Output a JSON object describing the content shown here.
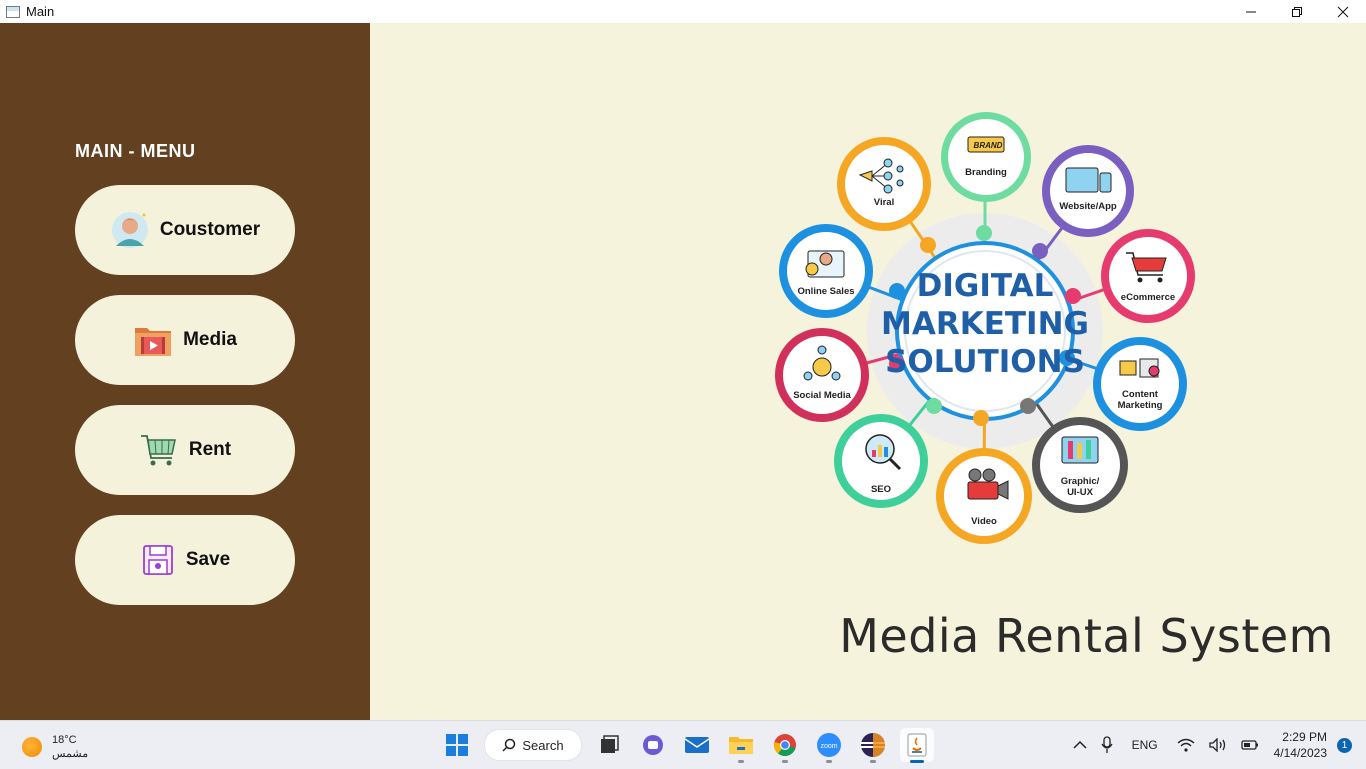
{
  "window": {
    "title": "Main"
  },
  "sidebar": {
    "menu_title": "MAIN - MENU",
    "buttons": [
      {
        "label": "Coustomer",
        "icon": "customer-avatar-icon"
      },
      {
        "label": "Media",
        "icon": "media-folder-icon"
      },
      {
        "label": "Rent",
        "icon": "shopping-cart-icon"
      },
      {
        "label": "Save",
        "icon": "save-disk-icon"
      }
    ]
  },
  "main": {
    "heading": "Media Rental System",
    "infographic": {
      "center_lines": [
        "DIGITAL",
        "MARKETING",
        "SOLUTIONS"
      ],
      "nodes": [
        "Branding",
        "Website/App",
        "eCommerce",
        "Content Marketing",
        "Graphic/ UI-UX",
        "Video",
        "SEO",
        "Social Media",
        "Online Sales",
        "Viral"
      ]
    }
  },
  "taskbar": {
    "weather": {
      "temp": "18°C",
      "condition": "مشمس"
    },
    "search_label": "Search",
    "apps": [
      "start-icon",
      "search",
      "task-view-icon",
      "chat-icon",
      "mail-icon",
      "file-explorer-icon",
      "chrome-icon",
      "zoom-icon",
      "eclipse-icon",
      "java-icon"
    ],
    "tray": {
      "language": "ENG",
      "time": "2:29 PM",
      "date": "4/14/2023",
      "notifications": "1"
    }
  },
  "colors": {
    "sidebar_bg": "#634020",
    "main_bg": "#f5f3dc",
    "button_bg": "#f5f2dc"
  }
}
